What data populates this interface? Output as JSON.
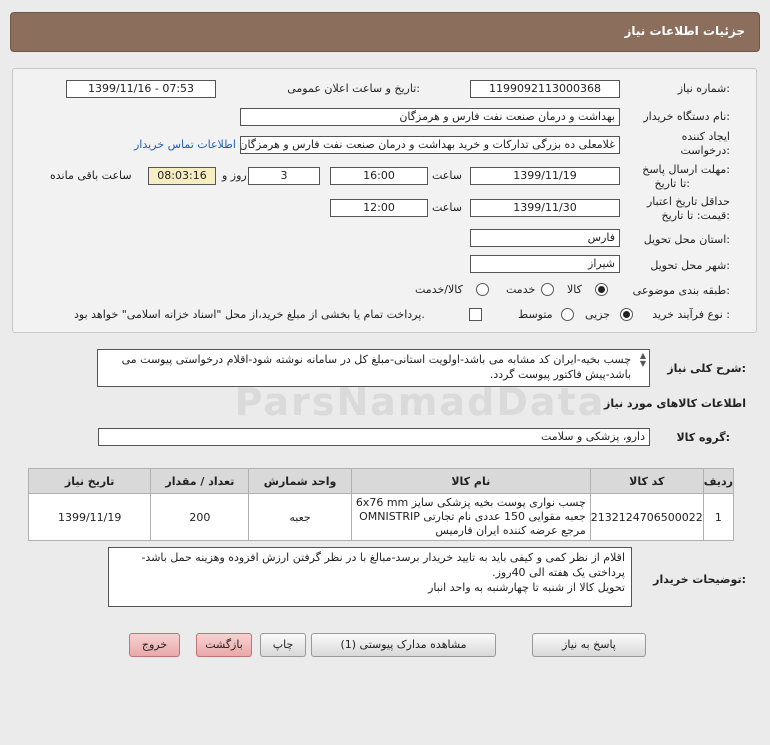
{
  "header": {
    "title": "جزئیات اطلاعات نیاز"
  },
  "form": {
    "need_number": {
      "label": "شماره نیاز:",
      "value": "1199092113000368"
    },
    "announce_datetime": {
      "label": "تاریخ و ساعت اعلان عمومی:",
      "value": "1399/11/16 - 07:53"
    },
    "buyer_org": {
      "label": "نام دستگاه خریدار:",
      "value": "بهداشت و درمان صنعت نفت فارس و هرمزگان"
    },
    "requester": {
      "label_line1": "ایجاد کننده",
      "label_line2": "درخواست:",
      "value": "غلامعلی ده بزرگی تدارکات و خرید بهداشت و درمان صنعت نفت فارس و هرمزگان",
      "contact_link": "اطلاعات تماس خریدار"
    },
    "reply_deadline": {
      "label_line1": "مهلت ارسال پاسخ:",
      "label_line2": "تا تاریخ:",
      "date": "1399/11/19",
      "time_label": "ساعت",
      "time": "16:00",
      "days": "3",
      "days_label": "روز و",
      "remaining": "08:03:16",
      "remaining_label": "ساعت باقی مانده"
    },
    "price_validity": {
      "label_line1": "حداقل تاریخ اعتبار",
      "label_line2": "قیمت: تا تاریخ:",
      "date": "1399/11/30",
      "time_label": "ساعت",
      "time": "12:00"
    },
    "province": {
      "label": "استان محل تحویل:",
      "value": "فارس"
    },
    "city": {
      "label": "شهر محل تحویل:",
      "value": "شیراز"
    },
    "category": {
      "label": "طبقه بندی موضوعی:",
      "options": [
        "کالا",
        "خدمت",
        "کالا/خدمت"
      ],
      "selected": "کالا"
    },
    "process_type": {
      "label": "نوع فرآیند خرید :",
      "options": [
        "جزیی",
        "متوسط"
      ],
      "selected": "جزیی",
      "payment_note": "پرداخت تمام یا بخشی از مبلغ خرید،از محل \"اسناد خزانه اسلامی\" خواهد بود."
    }
  },
  "description": {
    "label": "شرح کلی نیاز:",
    "text": "چسب بخیه-ایران کد مشابه می باشد-اولویت استانی-مبلغ کل در سامانه نوشته شود-اقلام درخواستی پیوست می باشد-پیش فاکتور پیوست گردد."
  },
  "goods_section": {
    "title": "اطلاعات کالاهای مورد نیاز",
    "group_label": "گروه کالا:",
    "group_value": "دارو، پزشکی و سلامت"
  },
  "table": {
    "headers": [
      "ردیف",
      "کد کالا",
      "نام کالا",
      "واحد شمارش",
      "تعداد / مقدار",
      "تاریخ نیاز"
    ],
    "rows": [
      {
        "row": "1",
        "code": "2132124706500022",
        "name": "چسب نواری پوست بخیه پزشکی سایز 6x76 mm جعبه مقوایی 150 عددی نام تجارتی OMNISTRIP مرجع عرضه کننده ایران فارمیس",
        "unit": "جعبه",
        "qty": "200",
        "date": "1399/11/19"
      }
    ]
  },
  "buyer_notes": {
    "label": "توضیحات خریدار:",
    "lines": [
      "اقلام از نظر کمی و کیفی باید به تایید خریدار برسد-مبالغ با در نظر گرفتن ارزش افزوده وهزینه حمل باشد-پرداختی یک هفته الی 40روز.",
      "تحویل کالا از شنبه تا چهارشنبه به واحد انبار"
    ]
  },
  "buttons": {
    "reply": "پاسخ به نیاز",
    "attachments": "مشاهده مدارک پیوستی (1)",
    "print": "چاپ",
    "back": "بازگشت",
    "exit": "خروج"
  },
  "watermark": "ParsNamadData"
}
